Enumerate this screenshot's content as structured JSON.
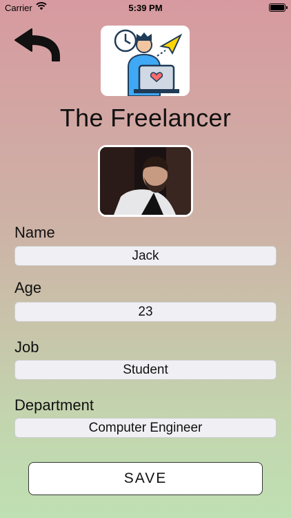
{
  "status_bar": {
    "carrier": "Carrier",
    "time": "5:39 PM",
    "battery_level": 1.0
  },
  "header": {
    "back_icon": "back-arrow-icon",
    "logo_icon": "freelancer-logo-icon",
    "title": "The Freelancer"
  },
  "profile": {
    "avatar_icon": "user-photo"
  },
  "form": {
    "name_label": "Name",
    "name_value": "Jack",
    "age_label": "Age",
    "age_value": "23",
    "job_label": "Job",
    "job_value": "Student",
    "department_label": "Department",
    "department_value": "Computer Engineer"
  },
  "actions": {
    "save_label": "SAVE"
  },
  "colors": {
    "gradient_top": "#d79aa0",
    "gradient_bottom": "#bfe0b2",
    "field_background": "#f0eff4"
  }
}
